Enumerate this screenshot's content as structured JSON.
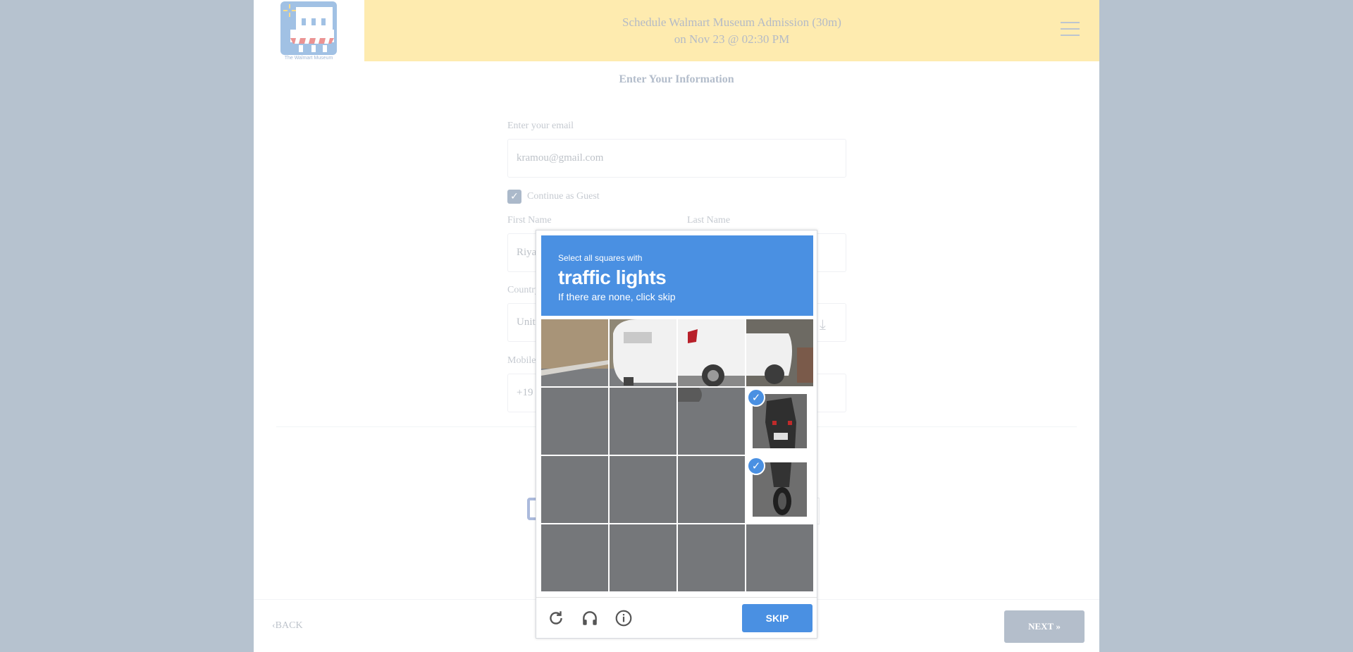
{
  "header": {
    "logo_text": "The Walmart Museum",
    "title_line1": "Schedule Walmart Museum Admission (30m)",
    "title_line2": "on Nov 23 @ 02:30 PM"
  },
  "form": {
    "heading": "Enter Your Information",
    "email_label": "Enter your email",
    "email_value": "kramou@gmail.com",
    "guest_label": "Continue as Guest",
    "guest_checked": true,
    "first_name_label": "First Name",
    "first_name_value": "Riya",
    "last_name_label": "Last Name",
    "country_label": "Country",
    "country_value": "Unit",
    "mobile_label": "Mobile",
    "mobile_value": "+19"
  },
  "footer": {
    "back_label": "BACK",
    "next_label": "NEXT"
  },
  "captcha": {
    "instruction_small": "Select all squares with",
    "instruction_target": "traffic lights",
    "instruction_sub": "If there are none, click skip",
    "skip_label": "SKIP",
    "selected_tiles": [
      7,
      11
    ],
    "icons": [
      "refresh-icon",
      "audio-icon",
      "info-icon"
    ],
    "accent_color": "#4a90e2"
  }
}
